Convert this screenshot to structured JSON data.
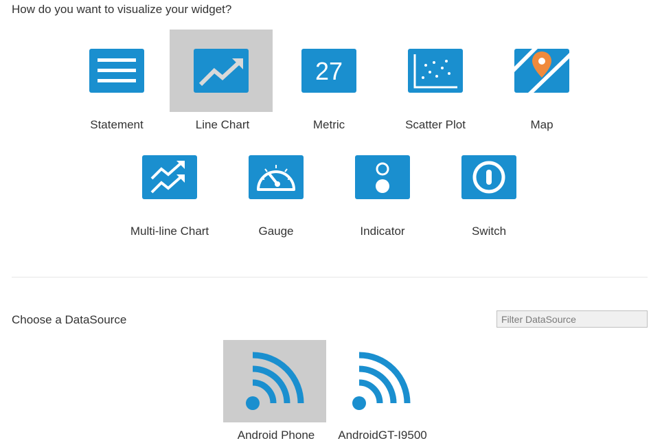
{
  "visualize": {
    "heading": "How do you want to visualize your widget?",
    "options": [
      {
        "label": "Statement",
        "icon": "statement-icon",
        "selected": false
      },
      {
        "label": "Line Chart",
        "icon": "line-chart-icon",
        "selected": true
      },
      {
        "label": "Metric",
        "icon": "metric-icon",
        "value_text": "27",
        "selected": false
      },
      {
        "label": "Scatter Plot",
        "icon": "scatter-plot-icon",
        "selected": false
      },
      {
        "label": "Map",
        "icon": "map-icon",
        "selected": false
      },
      {
        "label": "Multi-line Chart",
        "icon": "multi-line-chart-icon",
        "selected": false
      },
      {
        "label": "Gauge",
        "icon": "gauge-icon",
        "selected": false
      },
      {
        "label": "Indicator",
        "icon": "indicator-icon",
        "selected": false
      },
      {
        "label": "Switch",
        "icon": "switch-icon",
        "selected": false
      }
    ]
  },
  "datasource": {
    "heading": "Choose a DataSource",
    "filter_placeholder": "Filter DataSource",
    "filter_value": "",
    "items": [
      {
        "label": "Android Phone",
        "icon": "wifi-signal-icon",
        "selected": true
      },
      {
        "label": "AndroidGT-I9500",
        "icon": "wifi-signal-icon",
        "selected": false
      }
    ]
  },
  "colors": {
    "accent": "#1a8fcf",
    "selected_bg": "#cccccc",
    "map_pin": "#f08a3c",
    "text": "#333333"
  }
}
